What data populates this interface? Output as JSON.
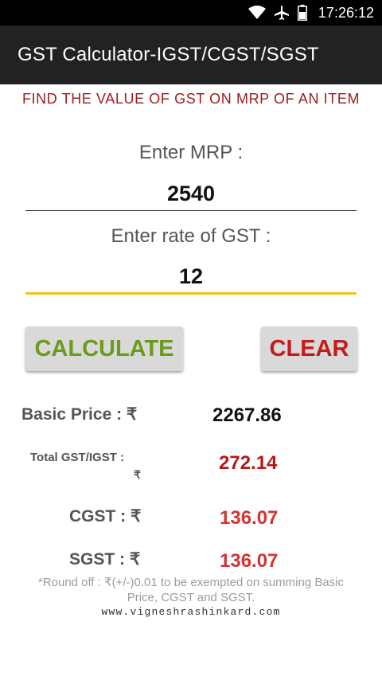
{
  "status_bar": {
    "time": "17:26:12",
    "icons": [
      "wifi-icon",
      "airplane-icon",
      "battery-icon"
    ]
  },
  "app_bar": {
    "title": "GST Calculator-IGST/CGST/SGST"
  },
  "subtitle": "FIND THE VALUE OF GST ON MRP OF AN ITEM",
  "form": {
    "mrp_label": "Enter MRP :",
    "mrp_value": "2540",
    "gst_rate_label": "Enter rate of GST :",
    "gst_rate_value": "12"
  },
  "buttons": {
    "calculate": "CALCULATE",
    "clear": "CLEAR"
  },
  "results": {
    "basic_price_label": "Basic Price : ₹",
    "basic_price_value": "2267.86",
    "total_gst_label_line1": "Total GST/IGST :",
    "total_gst_label_line2": "₹",
    "total_gst_value": "272.14",
    "cgst_label": "CGST : ₹",
    "cgst_value": "136.07",
    "sgst_label": "SGST : ₹",
    "sgst_value": "136.07"
  },
  "footer": {
    "note_line1": "*Round off : ₹(+/-)0.01 to be exempted on summing Basic",
    "note_line2": "Price, CGST and SGST.",
    "website": "www.vigneshrashinkard.com"
  },
  "colors": {
    "accent_underline": "#f0c419",
    "title_red": "#a01c1c",
    "calculate_green": "#6a9b1a",
    "clear_red": "#c41a1a",
    "total_gst_red": "#b31818",
    "cgst_sgst_red": "#cf3535"
  }
}
